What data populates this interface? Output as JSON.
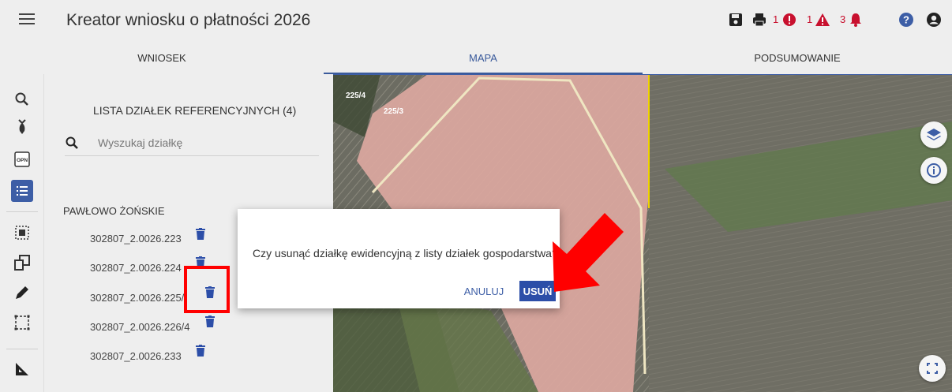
{
  "app": {
    "title": "Kreator wniosku o płatności 2026"
  },
  "toolbar": {
    "error_count": "1",
    "warning_count": "1",
    "notification_count": "3"
  },
  "tabs": [
    {
      "label": "WNIOSEK",
      "active": false
    },
    {
      "label": "MAPA",
      "active": true
    },
    {
      "label": "PODSUMOWANIE",
      "active": false
    }
  ],
  "panel": {
    "title": "LISTA DZIAŁEK REFERENCYJNYCH (4)",
    "search_placeholder": "Wyszukaj działkę",
    "section_title": "PAWŁOWO ŻOŃSKIE",
    "parcels": [
      "302807_2.0026.223",
      "302807_2.0026.224",
      "302807_2.0026.225/",
      "302807_2.0026.226/4",
      "302807_2.0026.233"
    ]
  },
  "map": {
    "labels": [
      "225/4",
      "225/3"
    ]
  },
  "dialog": {
    "message": "Czy usunąć działkę ewidencyjną z listy działek gospodarstwa?",
    "cancel_label": "ANULUJ",
    "confirm_label": "USUŃ"
  },
  "colors": {
    "accent": "#3d5ea6",
    "confirm": "#2c4ea8",
    "highlight": "#ff0000",
    "error": "#c8102e"
  }
}
